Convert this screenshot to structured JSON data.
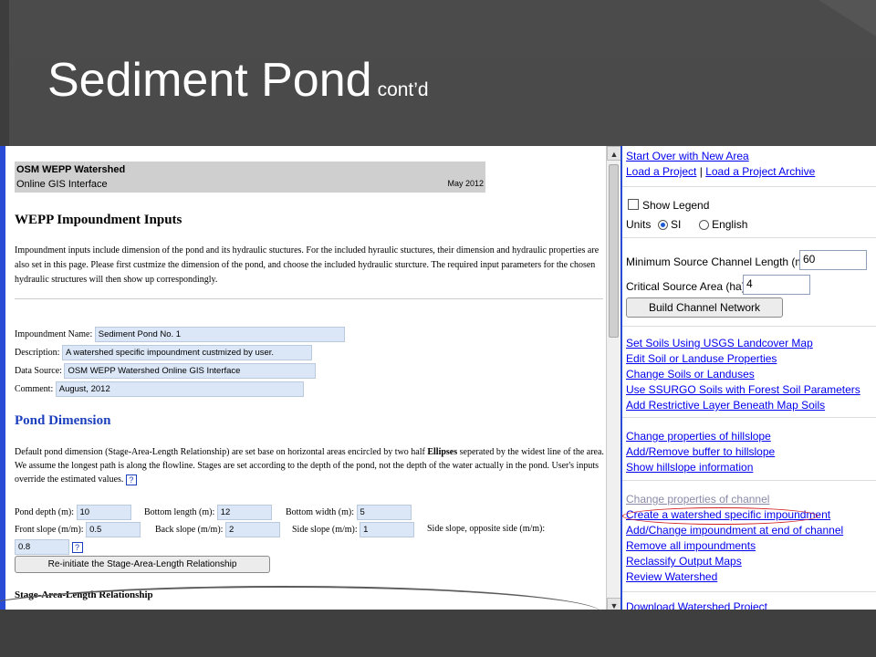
{
  "slide": {
    "title": "Sediment Pond",
    "subtitle": "cont’d"
  },
  "header": {
    "line1": "OSM WEPP Watershed",
    "line2": "Online GIS Interface",
    "date": "May 2012"
  },
  "impoundment": {
    "heading": "WEPP Impoundment Inputs",
    "intro": "Impoundment inputs include dimension of the pond and its hydraulic stuctures. For the included hyraulic stuctures, their dimension and hydraulic properties are also set in this page. Please first custmize the dimension of the pond, and choose the included hydraulic sturcture. The required input parameters for the chosen hydraulic structures will then show up correspondingly.",
    "name_label": "Impoundment Name:",
    "name_value": "Sediment Pond No. 1",
    "desc_label": "Description:",
    "desc_value": "A watershed specific impoundment custmized by user.",
    "source_label": "Data Source:",
    "source_value": "OSM WEPP Watershed Online GIS Interface",
    "comment_label": "Comment:",
    "comment_value": "August, 2012"
  },
  "pond": {
    "heading": "Pond Dimension",
    "text_a": "Default pond dimension (Stage-Area-Length Relationship) are set base on horizontal areas encircled by two half ",
    "text_bold": "Ellipses",
    "text_b": " seperated by the widest line of the area. We assume the longest path is along the flowline. Stages are set according to the depth of the pond, not the depth of the water actually in the pond. User's inputs override the estimated values.",
    "help": "?",
    "depth_label": "Pond depth (m):",
    "depth_value": "10",
    "bottom_length_label": "Bottom length (m):",
    "bottom_length_value": "12",
    "bottom_width_label": "Bottom width (m):",
    "bottom_width_value": "5",
    "front_slope_label": "Front slope (m/m):",
    "front_slope_value": "0.5",
    "back_slope_label": "Back slope (m/m):",
    "back_slope_value": "2",
    "side_slope_label": "Side slope (m/m):",
    "side_slope_value": "1",
    "side_opp_label": "Side slope, opposite side (m/m):",
    "side_opp_value": "0.8",
    "reinit_button": "Re-initiate the Stage-Area-Length Relationship",
    "sal_heading": "Stage-Area-Length Relationship"
  },
  "sidebar": {
    "start_over": "Start Over with New Area",
    "load_project": "Load a Project",
    "sep": "|",
    "load_archive": "Load a Project Archive",
    "show_legend": "Show Legend",
    "units_label": "Units",
    "unit_si": "SI",
    "unit_english": "English",
    "min_channel_label": "Minimum Source Channel Length (m):",
    "min_channel_value": "60",
    "critical_area_label": "Critical Source Area (ha):",
    "critical_area_value": "4",
    "build_button": "Build Channel Network",
    "soil_links": [
      "Set Soils Using USGS Landcover Map",
      "Edit Soil or Landuse Properties",
      "Change Soils or Landuses",
      "Use SSURGO Soils with Forest Soil Parameters",
      "Add Restrictive Layer Beneath Map Soils"
    ],
    "hill_links": [
      "Change properties of hillslope",
      "Add/Remove buffer to hillslope",
      "Show hillslope information"
    ],
    "channel_disabled": "Change properties of channel",
    "impound_links": [
      "Create a watershed specific impoundment",
      "Add/Change impoundment at end of channel",
      "Remove all impoundments",
      "Reclassify Output Maps",
      "Review Watershed"
    ],
    "download": "Download Watershed Project"
  },
  "colors": {
    "link": "#0000ee",
    "heading_blue": "#1b3fbd",
    "highlight_ellipse": "#d42020",
    "input_fill": "#dbe7f7"
  }
}
